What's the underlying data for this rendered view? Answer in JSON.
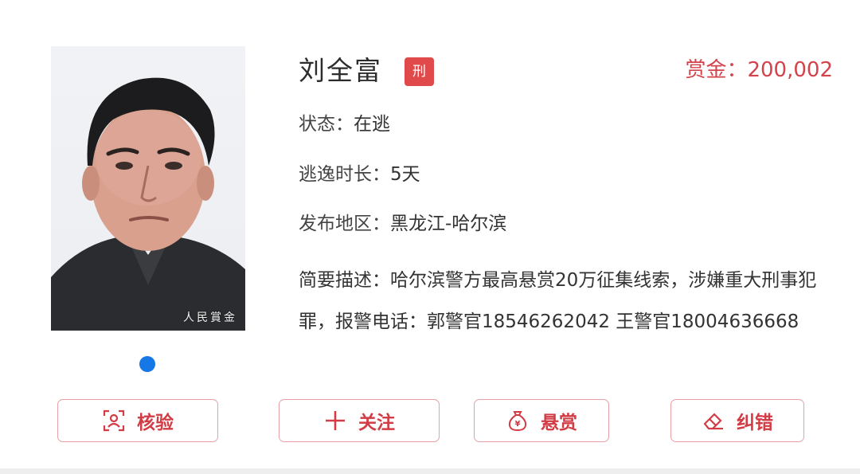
{
  "photo": {
    "watermark": "人民賞金"
  },
  "carousel": {
    "active_index": 1,
    "count": 1
  },
  "person": {
    "name": "刘全富",
    "badge": "刑"
  },
  "reward": {
    "label": "赏金：",
    "amount": "200,002"
  },
  "fields": {
    "status": {
      "label": "状态：",
      "value": "在逃"
    },
    "duration": {
      "label": "逃逸时长：",
      "value": "5天"
    },
    "region": {
      "label": "发布地区：",
      "value": "黑龙江-哈尔滨"
    },
    "description": {
      "label": "简要描述：",
      "value": "哈尔滨警方最高悬赏20万征集线索，涉嫌重大刑事犯罪，报警电话：郭警官18546262042 王警官18004636668"
    }
  },
  "actions": [
    {
      "label": "核验",
      "icon": "verify-person-icon"
    },
    {
      "label": "关注",
      "icon": "plus-icon"
    },
    {
      "label": "悬赏",
      "icon": "money-bag-icon"
    },
    {
      "label": "纠错",
      "icon": "eraser-icon"
    }
  ],
  "colors": {
    "accent": "#d23c45",
    "badge": "#e04a4a",
    "dot": "#1677e6",
    "button_border": "#e8a0a4"
  }
}
